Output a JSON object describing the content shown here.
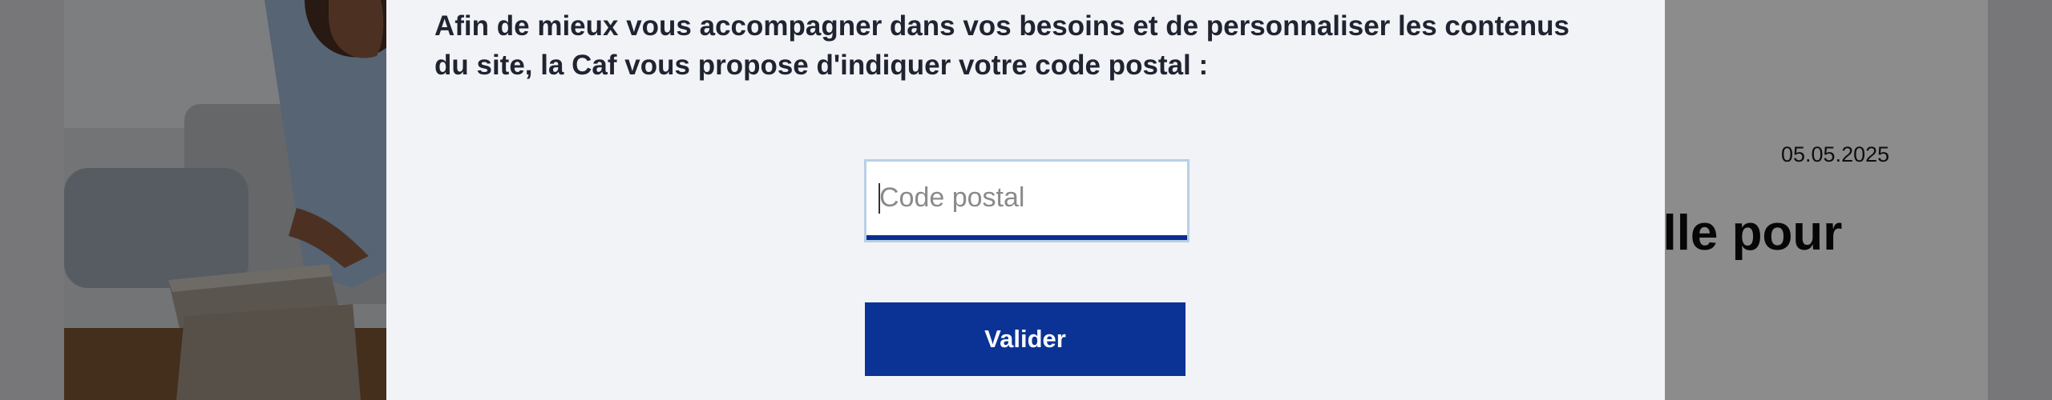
{
  "background_page": {
    "date": "05.05.2025",
    "headline_fragment": "elle pour"
  },
  "modal": {
    "message": "Afin de mieux vous accompagner dans vos besoins et de personnaliser les contenus du site, la Caf vous propose d'indiquer votre code postal :",
    "postal_code": {
      "value": "",
      "placeholder": "Code postal"
    },
    "submit_label": "Valider"
  },
  "colors": {
    "modal_background": "#f2f3f7",
    "primary_button": "#0b3396",
    "input_underline": "#0b2f8f",
    "input_focus_border": "#b9cfe6"
  }
}
